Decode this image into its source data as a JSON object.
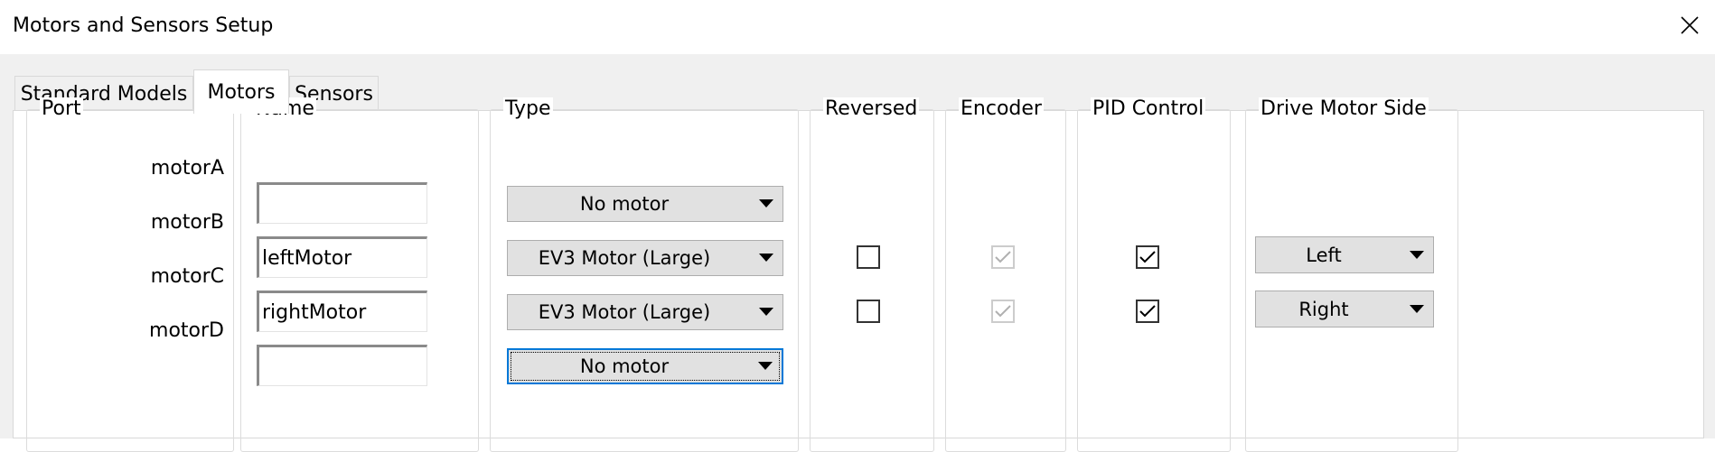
{
  "window": {
    "title": "Motors and Sensors Setup",
    "close_icon": "close-icon"
  },
  "tabs": [
    {
      "label": "Standard Models",
      "active": false
    },
    {
      "label": "Motors",
      "active": true
    },
    {
      "label": "Sensors",
      "active": false
    }
  ],
  "groups": {
    "port": "Port",
    "name": "Name",
    "type": "Type",
    "reversed": "Reversed",
    "encoder": "Encoder",
    "pid": "PID Control",
    "drive_side": "Drive Motor Side"
  },
  "motors": [
    {
      "port": "motorA",
      "name": "",
      "type": "No motor",
      "reversed": null,
      "encoder": null,
      "pid": null,
      "drive_side": null
    },
    {
      "port": "motorB",
      "name": "leftMotor",
      "type": "EV3 Motor (Large)",
      "reversed": false,
      "encoder": true,
      "pid": true,
      "drive_side": "Left"
    },
    {
      "port": "motorC",
      "name": "rightMotor",
      "type": "EV3 Motor (Large)",
      "reversed": false,
      "encoder": true,
      "pid": true,
      "drive_side": "Right"
    },
    {
      "port": "motorD",
      "name": "",
      "type": "No motor",
      "reversed": null,
      "encoder": null,
      "pid": null,
      "drive_side": null
    }
  ],
  "colors": {
    "focus": "#0078d7",
    "dialog_bg": "#f0f0f0",
    "disabled_check": "#b0b0b0"
  }
}
